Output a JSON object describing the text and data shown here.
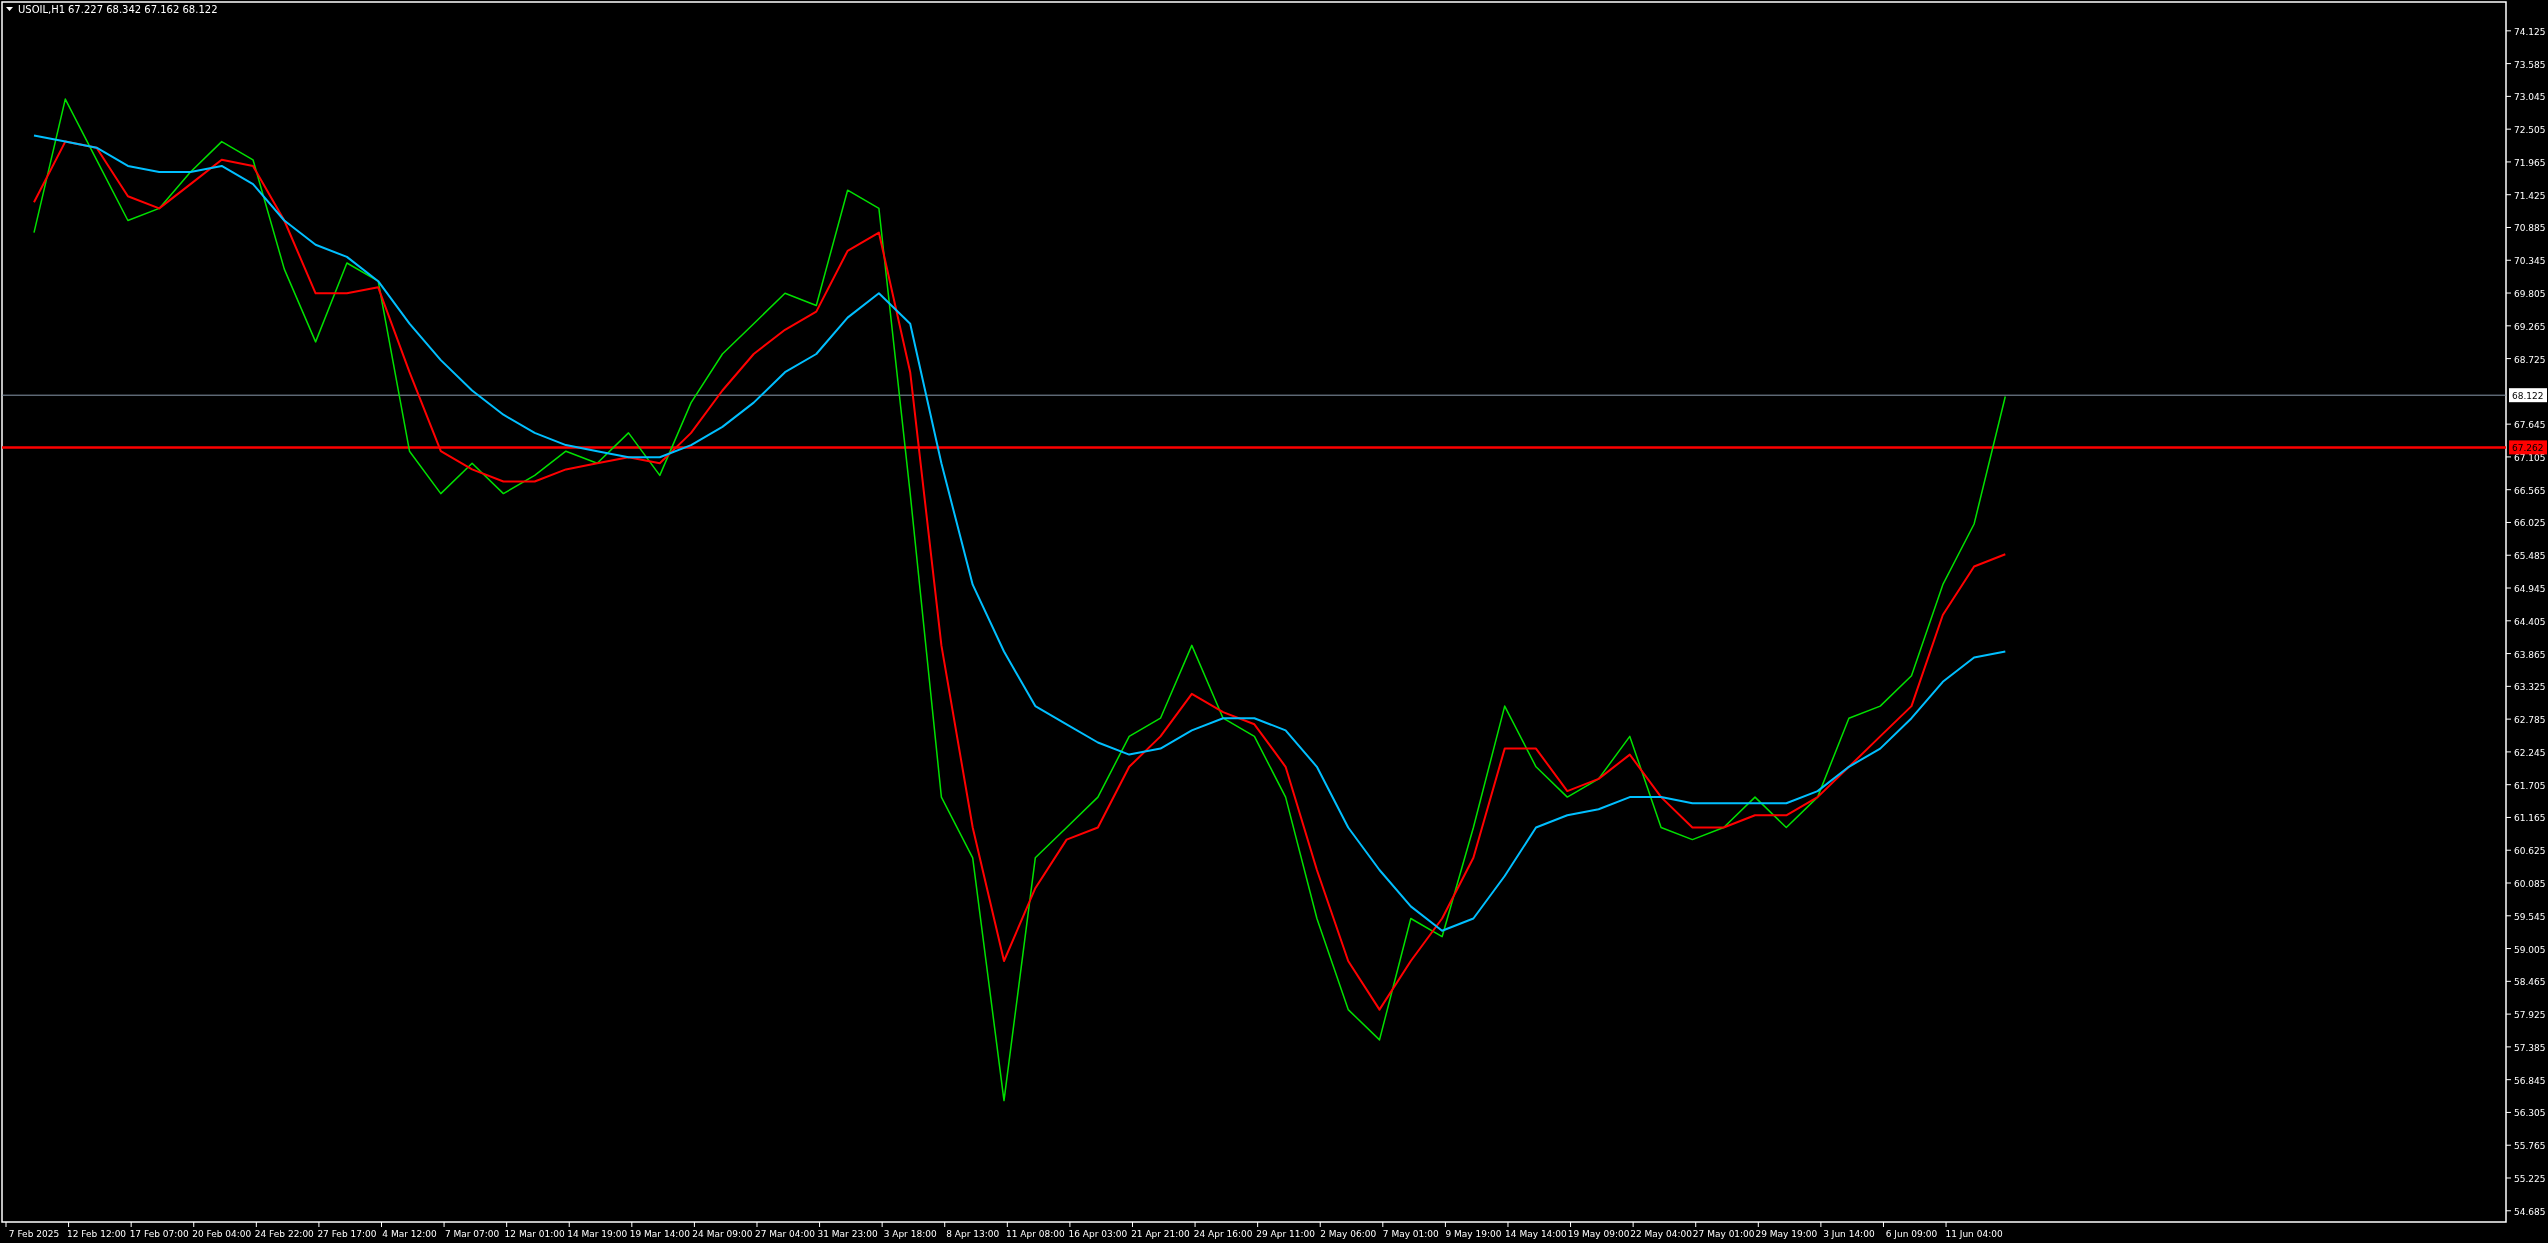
{
  "header": {
    "symbol": "USOIL,H1",
    "ohlc": "67.227 68.342 67.162 68.122"
  },
  "chart": {
    "chart_data": {
      "type": "line",
      "categories": [
        "7 Feb 2025",
        null,
        "12 Feb 12:00",
        null,
        "17 Feb 07:00",
        null,
        "20 Feb 04:00",
        null,
        "24 Feb 22:00",
        null,
        "27 Feb 17:00",
        null,
        "4 Mar 12:00",
        null,
        "7 Mar 07:00",
        null,
        "12 Mar 01:00",
        null,
        "14 Mar 19:00",
        null,
        "19 Mar 14:00",
        null,
        "24 Mar 09:00",
        null,
        "27 Mar 04:00",
        null,
        "31 Mar 23:00",
        null,
        "3 Apr 18:00",
        null,
        "8 Apr 13:00",
        null,
        "11 Apr 08:00",
        null,
        "16 Apr 03:00",
        null,
        "21 Apr 21:00",
        null,
        "24 Apr 16:00",
        null,
        "29 Apr 11:00",
        null,
        "2 May 06:00",
        null,
        "7 May 01:00",
        null,
        "9 May 19:00",
        null,
        "14 May 14:00",
        null,
        "19 May 09:00",
        null,
        "22 May 04:00",
        null,
        "27 May 01:00",
        null,
        "29 May 19:00",
        null,
        "3 Jun 14:00",
        null,
        "6 Jun 09:00",
        null,
        "11 Jun 04:00",
        null,
        null,
        null,
        null,
        null,
        null,
        null,
        null,
        null,
        null,
        null,
        null,
        null,
        null,
        null,
        null
      ],
      "series": [
        {
          "color": "#00e000",
          "values": [
            70.8,
            73.0,
            72.0,
            71.0,
            71.2,
            71.8,
            72.3,
            72.0,
            70.2,
            69.0,
            70.3,
            70.0,
            67.2,
            66.5,
            67.0,
            66.5,
            66.8,
            67.2,
            67.0,
            67.5,
            66.8,
            68.0,
            68.8,
            69.3,
            69.8,
            69.6,
            71.5,
            71.2,
            66.5,
            61.5,
            60.5,
            56.5,
            60.5,
            61.0,
            61.5,
            62.5,
            62.8,
            64.0,
            62.8,
            62.5,
            61.5,
            59.5,
            58.0,
            57.5,
            59.5,
            59.2,
            61.0,
            63.0,
            62.0,
            61.5,
            61.8,
            62.5,
            61.0,
            60.8,
            61.0,
            61.5,
            61.0,
            61.5,
            62.8,
            63.0,
            63.5,
            65.0,
            66.0,
            68.1,
            null,
            null,
            null,
            null,
            null,
            null,
            null,
            null,
            null,
            null,
            null,
            null,
            null,
            null,
            null
          ]
        },
        {
          "color": "#ff0000",
          "values": [
            71.3,
            72.3,
            72.2,
            71.4,
            71.2,
            71.6,
            72.0,
            71.9,
            71.0,
            69.8,
            69.8,
            69.9,
            68.5,
            67.2,
            66.9,
            66.7,
            66.7,
            66.9,
            67.0,
            67.1,
            67.0,
            67.5,
            68.2,
            68.8,
            69.2,
            69.5,
            70.5,
            70.8,
            68.5,
            64.0,
            61.0,
            58.8,
            60.0,
            60.8,
            61.0,
            62.0,
            62.5,
            63.2,
            62.9,
            62.7,
            62.0,
            60.3,
            58.8,
            58.0,
            58.8,
            59.5,
            60.5,
            62.3,
            62.3,
            61.6,
            61.8,
            62.2,
            61.5,
            61.0,
            61.0,
            61.2,
            61.2,
            61.5,
            62.0,
            62.5,
            63.0,
            64.5,
            65.3,
            65.5,
            null,
            null,
            null,
            null,
            null,
            null,
            null,
            null,
            null,
            null,
            null,
            null,
            null,
            null,
            null
          ]
        },
        {
          "color": "#00bfff",
          "values": [
            72.4,
            72.3,
            72.2,
            71.9,
            71.8,
            71.8,
            71.9,
            71.6,
            71.0,
            70.6,
            70.4,
            70.0,
            69.3,
            68.7,
            68.2,
            67.8,
            67.5,
            67.3,
            67.2,
            67.1,
            67.1,
            67.3,
            67.6,
            68.0,
            68.5,
            68.8,
            69.4,
            69.8,
            69.3,
            67.0,
            65.0,
            63.9,
            63.0,
            62.7,
            62.4,
            62.2,
            62.3,
            62.6,
            62.8,
            62.8,
            62.6,
            62.0,
            61.0,
            60.3,
            59.7,
            59.3,
            59.5,
            60.2,
            61.0,
            61.2,
            61.3,
            61.5,
            61.5,
            61.4,
            61.4,
            61.4,
            61.4,
            61.6,
            62.0,
            62.3,
            62.8,
            63.4,
            63.8,
            63.9,
            null,
            null,
            null,
            null,
            null,
            null,
            null,
            null,
            null,
            null,
            null,
            null,
            null,
            null,
            null
          ]
        }
      ],
      "ylim": [
        54.5,
        74.6
      ],
      "yticks": [
        {
          "value": 74.125,
          "label": "74.125"
        },
        {
          "value": 73.585,
          "label": "73.585"
        },
        {
          "value": 73.045,
          "label": "73.045"
        },
        {
          "value": 72.505,
          "label": "72.505"
        },
        {
          "value": 71.965,
          "label": "71.965"
        },
        {
          "value": 71.425,
          "label": "71.425"
        },
        {
          "value": 70.885,
          "label": "70.885"
        },
        {
          "value": 70.345,
          "label": "70.345"
        },
        {
          "value": 69.805,
          "label": "69.805"
        },
        {
          "value": 69.265,
          "label": "69.265"
        },
        {
          "value": 68.725,
          "label": "68.725"
        },
        {
          "value": 67.645,
          "label": "67.645"
        },
        {
          "value": 67.105,
          "label": "67.105"
        },
        {
          "value": 66.565,
          "label": "66.565"
        },
        {
          "value": 66.025,
          "label": "66.025"
        },
        {
          "value": 65.485,
          "label": "65.485"
        },
        {
          "value": 64.945,
          "label": "64.945"
        },
        {
          "value": 64.405,
          "label": "64.405"
        },
        {
          "value": 63.865,
          "label": "63.865"
        },
        {
          "value": 63.325,
          "label": "63.325"
        },
        {
          "value": 62.785,
          "label": "62.785"
        },
        {
          "value": 62.245,
          "label": "62.245"
        },
        {
          "value": 61.705,
          "label": "61.705"
        },
        {
          "value": 61.165,
          "label": "61.165"
        },
        {
          "value": 60.625,
          "label": "60.625"
        },
        {
          "value": 60.085,
          "label": "60.085"
        },
        {
          "value": 59.545,
          "label": "59.545"
        },
        {
          "value": 59.005,
          "label": "59.005"
        },
        {
          "value": 58.465,
          "label": "58.465"
        },
        {
          "value": 57.925,
          "label": "57.925"
        },
        {
          "value": 57.385,
          "label": "57.385"
        },
        {
          "value": 56.845,
          "label": "56.845"
        },
        {
          "value": 56.305,
          "label": "56.305"
        },
        {
          "value": 55.765,
          "label": "55.765"
        },
        {
          "value": 55.225,
          "label": "55.225"
        },
        {
          "value": 54.685,
          "label": "54.685"
        }
      ],
      "ref_lines": [
        {
          "axis": "y",
          "value": 68.122,
          "label": "68.122"
        },
        {
          "axis": "y",
          "value": 67.262,
          "label": "67.262"
        }
      ]
    }
  }
}
